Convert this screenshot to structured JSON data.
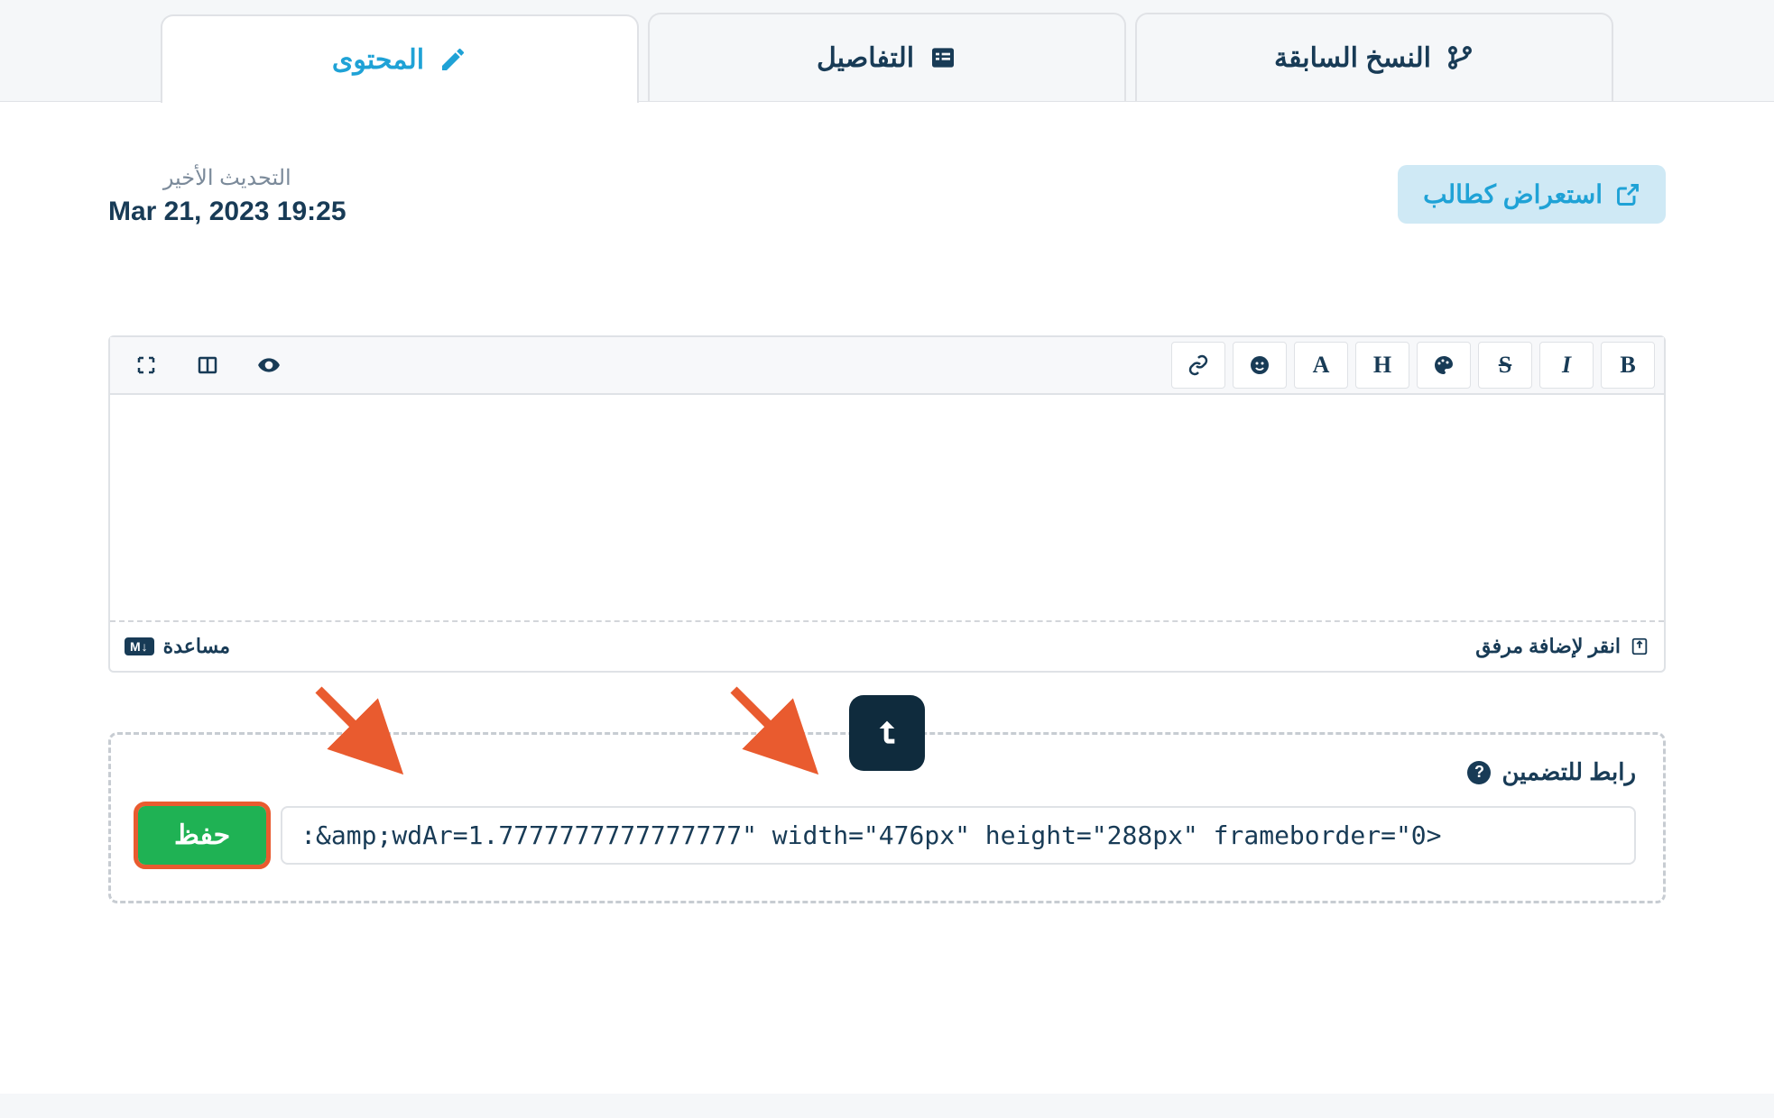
{
  "tabs": {
    "content": "المحتوى",
    "details": "التفاصيل",
    "previous_versions": "النسخ السابقة"
  },
  "preview_button": "استعراض كطالب",
  "last_update": {
    "label": "التحديث الأخير",
    "value": "Mar 21, 2023 19:25"
  },
  "editor": {
    "attach_label": "انقر لإضافة مرفق",
    "help_label": "مساعدة",
    "md_badge": "M↓"
  },
  "embed": {
    "label": "رابط للتضمين",
    "save": "حفظ",
    "value": ":&amp;wdAr=1.7777777777777777\" width=\"476px\" height=\"288px\" frameborder=\"0>"
  }
}
